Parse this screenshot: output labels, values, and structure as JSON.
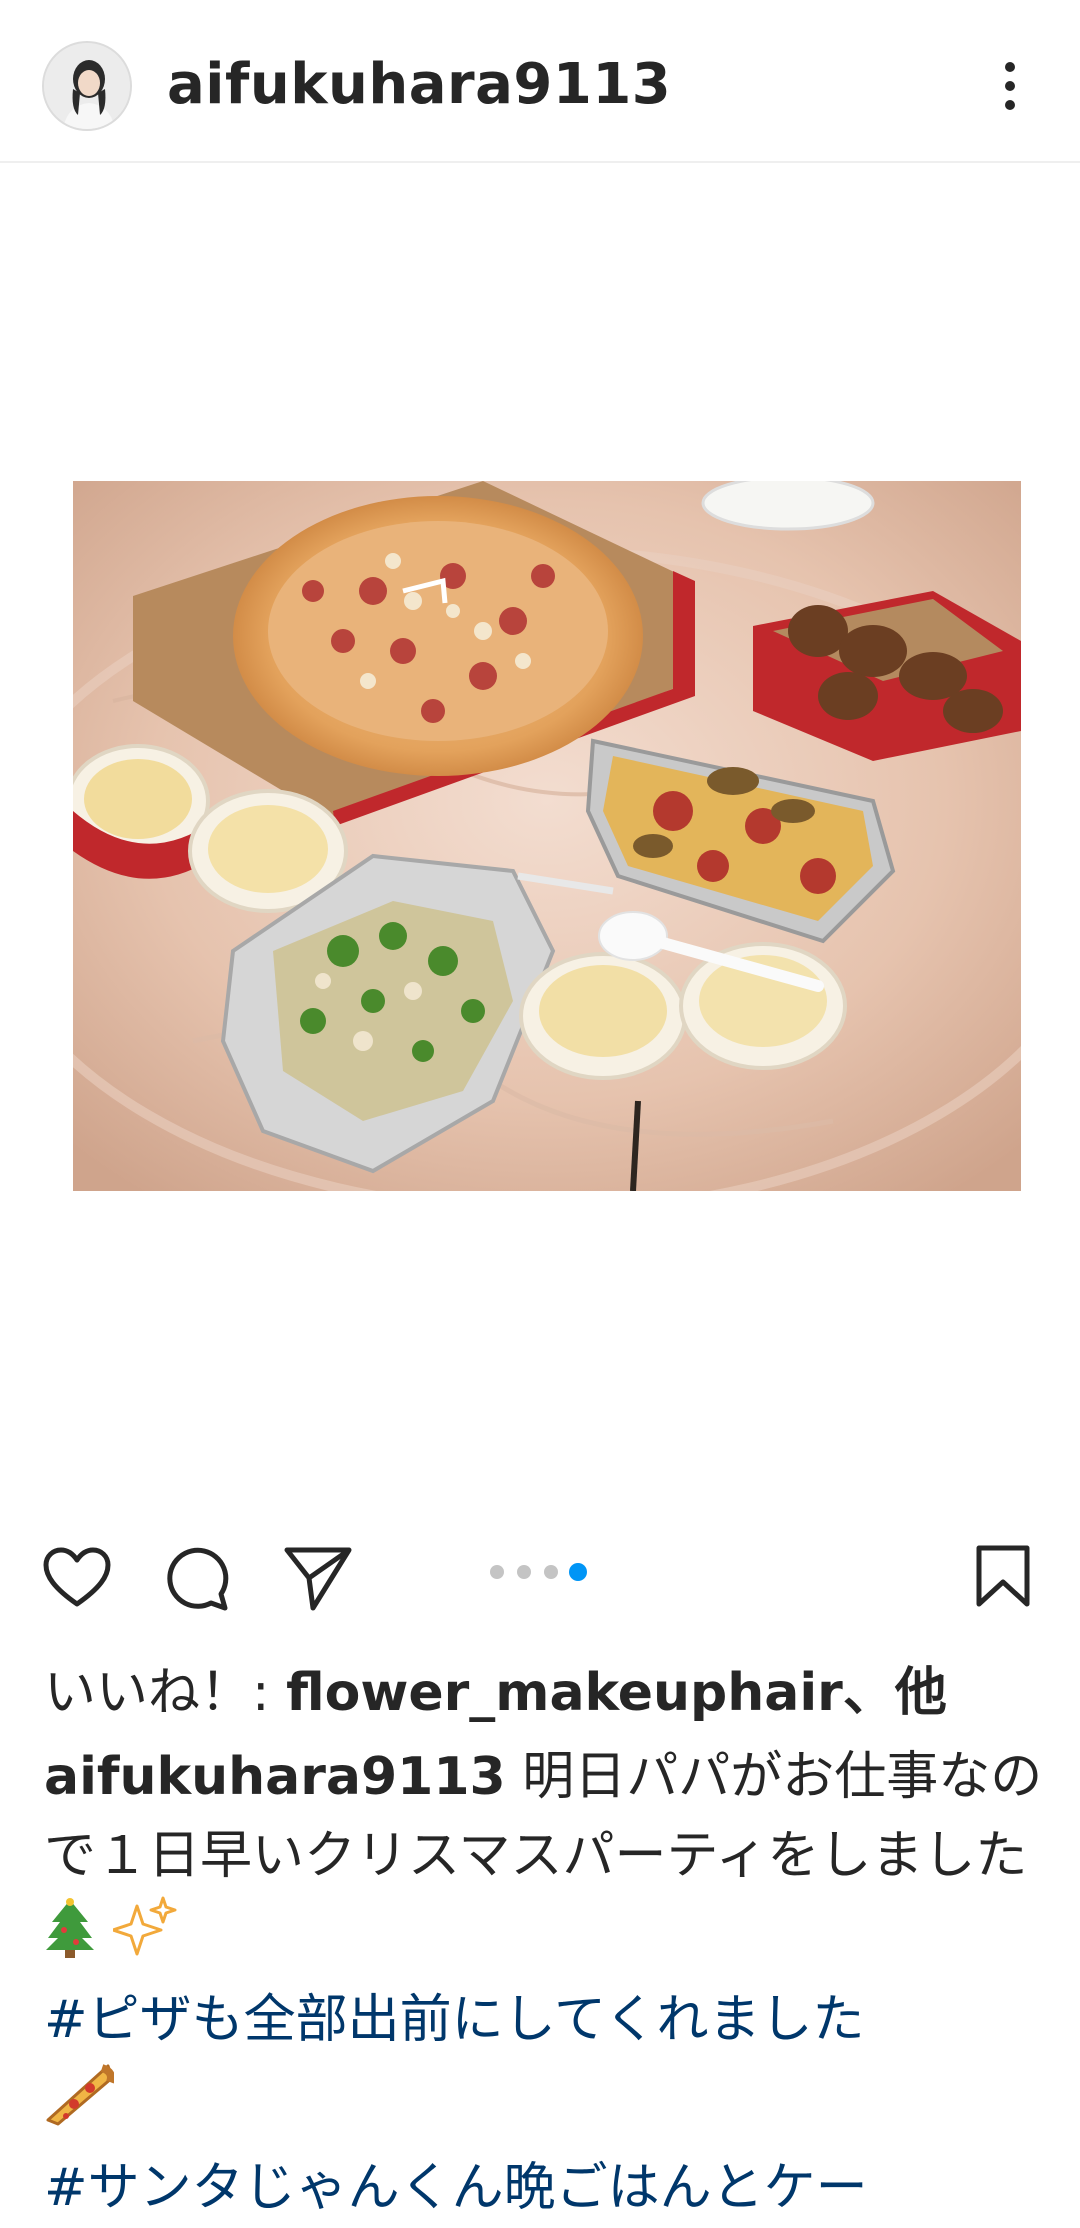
{
  "header": {
    "username": "aifukuhara9113"
  },
  "carousel": {
    "count": 4,
    "active_index": 3
  },
  "likes": {
    "prefix": "いいね！: ",
    "liker": "flower_makeuphair",
    "suffix": "、他"
  },
  "caption": {
    "author": "aifukuhara9113",
    "text": " 明日パパがお仕事なので１日早いクリスマスパーティをしました",
    "hashtag1": "#ピザも全部出前にしてくれました",
    "hashtag2": "#サンタじゃんくん晩ごはんとケー"
  },
  "colors": {
    "accent": "#0095f6",
    "hashtag": "#00376b",
    "text": "#262626"
  }
}
